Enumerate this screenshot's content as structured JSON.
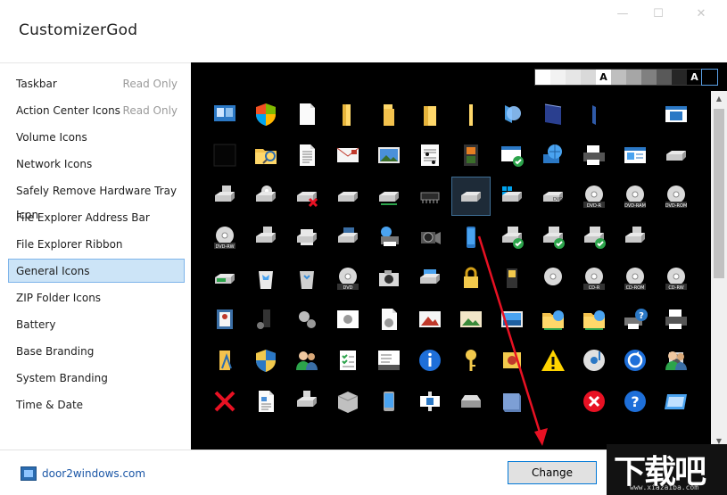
{
  "window": {
    "title": "CustomizerGod",
    "controls": [
      "—",
      "☐",
      "✕"
    ]
  },
  "sidebar": {
    "items": [
      {
        "label": "Taskbar",
        "status": "Read Only"
      },
      {
        "label": "Action Center Icons",
        "status": "Read Only"
      },
      {
        "label": "Volume Icons",
        "status": ""
      },
      {
        "label": "Network Icons",
        "status": ""
      },
      {
        "label": "Safely Remove Hardware Tray Icon",
        "status": ""
      },
      {
        "label": "File Explorer Address Bar",
        "status": ""
      },
      {
        "label": "File Explorer Ribbon",
        "status": ""
      },
      {
        "label": "General Icons",
        "status": "",
        "selected": true
      },
      {
        "label": "ZIP Folder Icons",
        "status": ""
      },
      {
        "label": "Battery",
        "status": ""
      },
      {
        "label": "Base Branding",
        "status": ""
      },
      {
        "label": "System Branding",
        "status": ""
      },
      {
        "label": "Time & Date",
        "status": ""
      }
    ]
  },
  "swatches": [
    {
      "color": "#ffffff",
      "label": ""
    },
    {
      "color": "#f2f2f2",
      "label": ""
    },
    {
      "color": "#e6e6e6",
      "label": ""
    },
    {
      "color": "#d9d9d9",
      "label": ""
    },
    {
      "color": "#ffffff",
      "label": "A",
      "text": "#000000"
    },
    {
      "color": "#bfbfbf",
      "label": ""
    },
    {
      "color": "#a6a6a6",
      "label": ""
    },
    {
      "color": "#808080",
      "label": ""
    },
    {
      "color": "#595959",
      "label": ""
    },
    {
      "color": "#262626",
      "label": ""
    },
    {
      "color": "#000000",
      "label": "A",
      "text": "#ffffff"
    },
    {
      "color": "#000000",
      "label": "",
      "selected": true
    }
  ],
  "icon_grid": {
    "selected_index": 34,
    "rows": [
      [
        "screens-icon",
        "shield-flag-icon",
        "blank-page-icon",
        "folder-icon",
        "folder-open-icon",
        "folder-half-icon",
        "folder-thin-icon",
        "globe-icon",
        "blue-book-icon",
        "sliver-icon",
        "empty-icon",
        "empty-icon",
        "window-blue-icon"
      ],
      [
        "black-square-icon",
        "folder-search-icon",
        "text-page-icon",
        "envelope-icon",
        "picture-icon",
        "music-sheet-icon",
        "film-strip-icon",
        "check-window-icon",
        "globe-monitor-icon",
        "printer-icon",
        "control-panel-icon",
        "drive-icon",
        "empty-icon"
      ],
      [
        "drive-stack-icon",
        "disc-drive-icon",
        "drive-error-icon",
        "drive-icon",
        "drive-network-icon",
        "chip-icon",
        "drive-selected-icon",
        "windows-drive-icon",
        "dvd-drive-icon",
        "dvd-r-icon",
        "dvd-ram-icon",
        "dvd-rom-icon",
        "empty-icon"
      ],
      [
        "dvd-rw-icon",
        "usb-drive-icon",
        "drive-small-icon",
        "database-icon",
        "network-printer-icon",
        "camcorder-icon",
        "phone-icon",
        "drive-check-icon",
        "drive-check-icon",
        "drive-check-icon",
        "drive-usb-icon",
        "empty-icon",
        "empty-icon"
      ],
      [
        "drive-green-icon",
        "recycle-full-icon",
        "recycle-empty-icon",
        "dvd-icon",
        "camera-icon",
        "computer-drive-icon",
        "lock-icon",
        "media-player-icon",
        "cd-icon",
        "cd-r-icon",
        "cd-rom-icon",
        "cd-rw-icon",
        "empty-icon"
      ],
      [
        "address-book-icon",
        "mp3-player-icon",
        "gears-icon",
        "gear-window-icon",
        "gear-page-icon",
        "picture-mountain-icon",
        "picture-landscape-icon",
        "picture-sea-icon",
        "network-folder-icon",
        "network-folder-icon",
        "printer-question-icon",
        "printer-icon",
        "empty-icon"
      ],
      [
        "folder-font-icon",
        "uac-shield-icon",
        "users-icon",
        "checklist-icon",
        "keyboard-icon",
        "info-icon",
        "key-icon",
        "puzzle-icon",
        "warning-icon",
        "music-disc-icon",
        "sync-icon",
        "speaker-icon",
        "users-icon"
      ],
      [
        "red-x-icon",
        "document-icon",
        "drive-down-icon",
        "generic-box-icon",
        "phone-tablet-icon",
        "video-icon",
        "scanner-icon",
        "cube-icon",
        "empty-icon",
        "error-icon",
        "help-icon",
        "window-icon",
        "empty-icon"
      ]
    ]
  },
  "footer": {
    "site": "door2windows.com",
    "change_label": "Change"
  },
  "watermark": {
    "main": "下载吧",
    "sub": "www.xiazaiba.com"
  },
  "colors": {
    "selection_bg": "#cce4f7",
    "selection_border": "#7eb4ea",
    "accent": "#0078d7",
    "arrow": "#e81123"
  }
}
